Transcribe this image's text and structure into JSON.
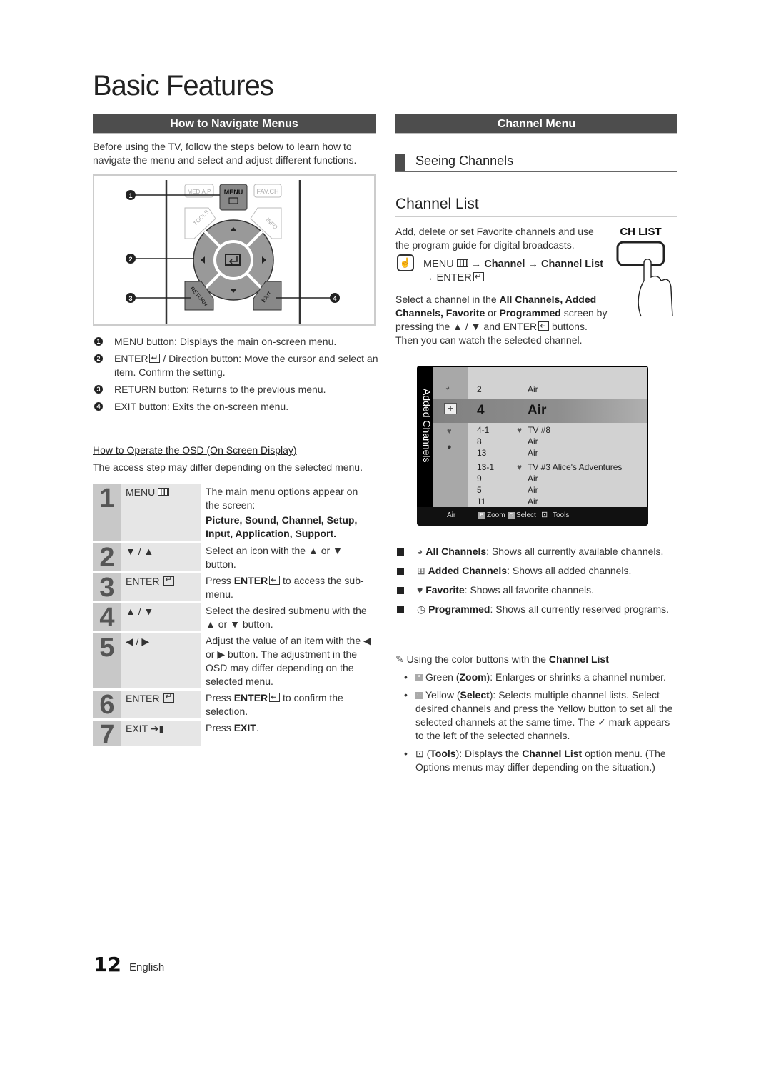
{
  "page": {
    "title": "Basic Features",
    "page_number": "12",
    "language": "English"
  },
  "left": {
    "section_title": "How to Navigate Menus",
    "intro": "Before using the TV, follow the steps below to learn how to navigate the menu and select and adjust different functions.",
    "remote": {
      "buttons": {
        "media_p": "MEDIA.P",
        "menu": "MENU",
        "fav_ch": "FAV.CH",
        "tools": "TOOLS",
        "info": "INFO",
        "return": "RETURN",
        "exit": "EXIT"
      },
      "callouts": [
        "1",
        "2",
        "3",
        "4"
      ]
    },
    "callouts": [
      {
        "num": "1",
        "key": "MENU",
        "text": " button: Displays the main on-screen menu."
      },
      {
        "num": "2",
        "key": "ENTER",
        "text": " / Direction button: Move the cursor and select an item. Confirm the setting."
      },
      {
        "num": "3",
        "key": "RETURN",
        "text": " button: Returns to the previous menu."
      },
      {
        "num": "4",
        "key": "EXIT",
        "text": " button: Exits the on-screen menu."
      }
    ],
    "osd_heading": "How to Operate the OSD (On Screen Display)",
    "osd_sub": "The access step may differ depending on the selected menu.",
    "steps": [
      {
        "num": "1",
        "key": "MENU",
        "key_icon": "menu-icon",
        "desc": "The main menu options appear on the screen:",
        "desc_bold": "Picture, Sound, Channel, Setup, Input, Application, Support."
      },
      {
        "num": "2",
        "key": "▼ / ▲",
        "desc": "Select an icon with the ▲ or ▼ button."
      },
      {
        "num": "3",
        "key": "ENTER",
        "key_icon": "enter-icon",
        "desc_pre": "Press ",
        "desc_key": "ENTER",
        "desc_post": " to access the sub-menu."
      },
      {
        "num": "4",
        "key": "▲ / ▼",
        "desc": "Select the desired submenu with the ▲ or ▼ button."
      },
      {
        "num": "5",
        "key": "◀ / ▶",
        "desc": "Adjust the value of an item with the ◀ or ▶ button. The adjustment in the OSD may differ depending on the selected menu."
      },
      {
        "num": "6",
        "key": "ENTER",
        "key_icon": "enter-icon",
        "desc_pre": "Press ",
        "desc_key": "ENTER",
        "desc_post": " to confirm the selection."
      },
      {
        "num": "7",
        "key": "EXIT ➔▮",
        "desc_pre": "Press ",
        "desc_key": "EXIT",
        "desc_post": "."
      }
    ]
  },
  "right": {
    "section_title": "Channel Menu",
    "subsection": "Seeing Channels",
    "heading": "Channel List",
    "intro": "Add, delete or set Favorite channels and use the program guide for digital broadcasts.",
    "ch_list_button": "CH LIST",
    "path": {
      "menu": "MENU",
      "arrow1": "→",
      "channel": "Channel",
      "arrow2": "→",
      "channel_list": "Channel List",
      "arrow3": "→",
      "enter": "ENTER"
    },
    "select_text": {
      "pre": "Select a channel in the ",
      "b1": "All Channels, Added Channels, Favorite",
      "mid": " or ",
      "b2": "Programmed",
      "post1": " screen by pressing the ▲ / ▼ and ",
      "enter": "ENTER",
      "post2": " buttons. Then you can watch the selected channel."
    },
    "osd": {
      "side_label": "Added Channels",
      "rows": [
        {
          "num": "2",
          "fav": false,
          "name": "Air"
        },
        {
          "num": "4",
          "fav": false,
          "name": "Air",
          "selected": true
        },
        {
          "num": "4-1",
          "fav": true,
          "name": "TV #8"
        },
        {
          "num": "8",
          "fav": false,
          "name": "Air"
        },
        {
          "num": "13",
          "fav": false,
          "name": "Air"
        },
        {
          "num": "13-1",
          "fav": true,
          "name": "TV #3 Alice's Adventures"
        },
        {
          "num": "9",
          "fav": false,
          "name": "Air"
        },
        {
          "num": "5",
          "fav": false,
          "name": "Air"
        },
        {
          "num": "11",
          "fav": false,
          "name": "Air"
        }
      ],
      "footer": {
        "source": "Air",
        "b_label": "B",
        "zoom": "Zoom",
        "c_label": "C",
        "select": "Select",
        "tools": "Tools"
      }
    },
    "bullets": [
      {
        "icon": "all-channels-icon",
        "label": "All Channels",
        "text": ": Shows all currently available channels."
      },
      {
        "icon": "added-channels-icon",
        "label": "Added Channels",
        "text": ": Shows all added channels."
      },
      {
        "icon": "favorite-icon",
        "label": "Favorite",
        "text": ": Shows all favorite channels."
      },
      {
        "icon": "programmed-icon",
        "label": "Programmed",
        "text": ": Shows all currently reserved programs."
      }
    ],
    "note": {
      "pre": "Using the color buttons with the ",
      "bold": "Channel List",
      "items": [
        {
          "btn": "B",
          "pre": "Green (",
          "bold": "Zoom",
          "post": "): Enlarges or shrinks a channel number."
        },
        {
          "btn": "C",
          "pre": "Yellow (",
          "bold": "Select",
          "post": "): Selects multiple channel lists. Select desired channels and press the Yellow button to set all the selected channels at the same time. The ✓ mark appears to the left of the selected channels."
        },
        {
          "btn": "tools",
          "pre": "(",
          "bold": "Tools",
          "post": "): Displays the ",
          "bold2": "Channel List",
          "post2": " option menu. (The Options menus may differ depending on the situation.)"
        }
      ]
    }
  }
}
